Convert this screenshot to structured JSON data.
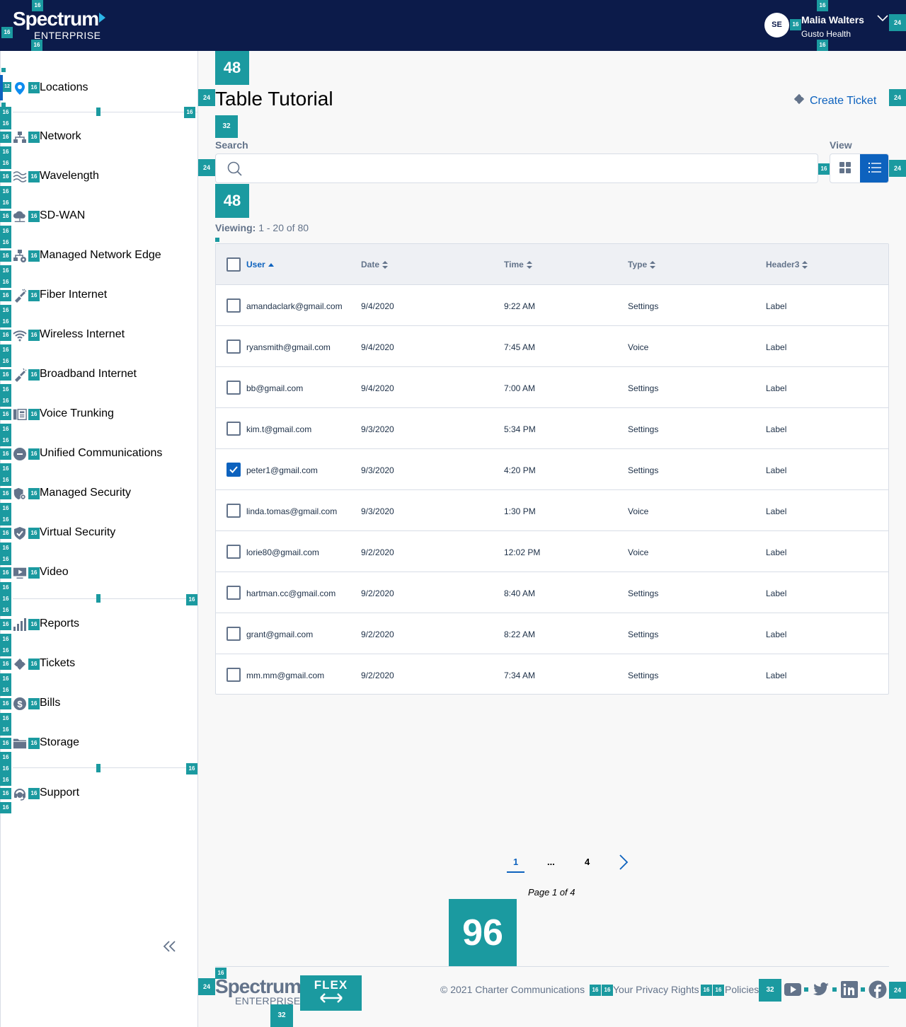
{
  "header": {
    "logo_top": "Spectrum",
    "logo_bottom": "ENTERPRISE",
    "avatar_initials": "SE",
    "user_name": "Malia Walters",
    "user_org": "Gusto Health"
  },
  "sidebar": {
    "items": [
      {
        "label": "Locations",
        "icon": "location-pin-icon"
      },
      {
        "label": "Network",
        "icon": "network-icon"
      },
      {
        "label": "Wavelength",
        "icon": "wavelength-icon"
      },
      {
        "label": "SD-WAN",
        "icon": "cloud-network-icon"
      },
      {
        "label": "Managed Network Edge",
        "icon": "managed-network-icon"
      },
      {
        "label": "Fiber Internet",
        "icon": "fiber-icon"
      },
      {
        "label": "Wireless Internet",
        "icon": "wifi-icon"
      },
      {
        "label": "Broadband Internet",
        "icon": "broadband-icon"
      },
      {
        "label": "Voice Trunking",
        "icon": "phone-system-icon"
      },
      {
        "label": "Unified Communications",
        "icon": "chat-icon"
      },
      {
        "label": "Managed Security",
        "icon": "shield-gear-icon"
      },
      {
        "label": "Virtual Security",
        "icon": "shield-check-icon"
      },
      {
        "label": "Video",
        "icon": "video-icon"
      },
      {
        "label": "Reports",
        "icon": "bar-chart-icon"
      },
      {
        "label": "Tickets",
        "icon": "ticket-icon"
      },
      {
        "label": "Bills",
        "icon": "dollar-icon"
      },
      {
        "label": "Storage",
        "icon": "folder-icon"
      },
      {
        "label": "Support",
        "icon": "headset-icon"
      }
    ]
  },
  "page": {
    "title": "Table Tutorial",
    "create_ticket": "Create Ticket",
    "search_label": "Search",
    "search_placeholder": "",
    "view_label": "View",
    "viewing_label": "Viewing:",
    "viewing_range": "1 - 20 of 80"
  },
  "table": {
    "headers": [
      "User",
      "Date",
      "Time",
      "Type",
      "Header3"
    ],
    "rows": [
      {
        "user": "amandaclark@gmail.com",
        "date": "9/4/2020",
        "time": "9:22 AM",
        "type": "Settings",
        "h3": "Label",
        "checked": false
      },
      {
        "user": "ryansmith@gmail.com",
        "date": "9/4/2020",
        "time": "7:45 AM",
        "type": "Voice",
        "h3": "Label",
        "checked": false
      },
      {
        "user": "bb@gmail.com",
        "date": "9/4/2020",
        "time": "7:00 AM",
        "type": "Settings",
        "h3": "Label",
        "checked": false
      },
      {
        "user": "kim.t@gmail.com",
        "date": "9/3/2020",
        "time": "5:34 PM",
        "type": "Settings",
        "h3": "Label",
        "checked": false
      },
      {
        "user": "peter1@gmail.com",
        "date": "9/3/2020",
        "time": "4:20 PM",
        "type": "Settings",
        "h3": "Label",
        "checked": true
      },
      {
        "user": "linda.tomas@gmail.com",
        "date": "9/3/2020",
        "time": "1:30 PM",
        "type": "Voice",
        "h3": "Label",
        "checked": false
      },
      {
        "user": "lorie80@gmail.com",
        "date": "9/2/2020",
        "time": "12:02 PM",
        "type": "Voice",
        "h3": "Label",
        "checked": false
      },
      {
        "user": "hartman.cc@gmail.com",
        "date": "9/2/2020",
        "time": "8:40 AM",
        "type": "Settings",
        "h3": "Label",
        "checked": false
      },
      {
        "user": "grant@gmail.com",
        "date": "9/2/2020",
        "time": "8:22 AM",
        "type": "Settings",
        "h3": "Label",
        "checked": false
      },
      {
        "user": "mm.mm@gmail.com",
        "date": "9/2/2020",
        "time": "7:34 AM",
        "type": "Settings",
        "h3": "Label",
        "checked": false
      }
    ]
  },
  "pagination": {
    "current": "1",
    "ellipsis": "...",
    "last": "4",
    "info": "Page 1 of 4"
  },
  "footer": {
    "logo_top": "Spectrum",
    "logo_bottom": "ENTERPRISE",
    "flex": "FLEX",
    "copyright": "© 2021 Charter Communications",
    "privacy": "Your Privacy Rights",
    "policies": "Policies"
  },
  "colors": {
    "header_bg": "#0c1b4a",
    "accent": "#0d62be",
    "redline": "#1b9aa0"
  }
}
